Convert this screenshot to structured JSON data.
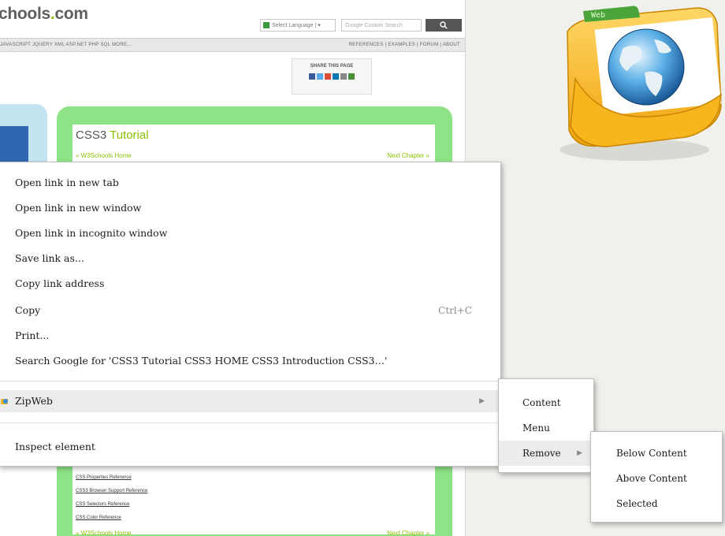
{
  "page": {
    "logo_prefix": "chools",
    "logo_dot": ".",
    "logo_suffix": "com",
    "lang_select": "Select Language | ▾",
    "search_placeholder": "Google Custom Search",
    "search_button_icon": "search-icon",
    "nav_left": "JAVASCRIPT   JQUERY   XML   ASP.NET   PHP   SQL   MORE...",
    "nav_right": "REFERENCES  |  EXAMPLES  |  FORUM  |  ABOUT",
    "share_title": "SHARE THIS PAGE",
    "tutorial_title_css3": "CSS3",
    "tutorial_title_rest": "Tutorial",
    "prev_link": "« W3Schools Home",
    "next_link": "Next Chapter »",
    "refs": [
      "CSS Properties Reference",
      "CSS3 Browser Support Reference",
      "CSS Selectors Reference",
      "CSS Color Reference"
    ],
    "prev_link_bottom": "« W3Schools Home",
    "next_link_bottom": "Next Chapter »"
  },
  "folder_label": "Web",
  "context_menu": {
    "items": [
      {
        "label": "Open link in new tab"
      },
      {
        "label": "Open link in new window"
      },
      {
        "label": "Open link in incognito window"
      },
      {
        "label": "Save link as..."
      },
      {
        "label": "Copy link address"
      },
      {
        "label": "Copy",
        "shortcut": "Ctrl+C"
      },
      {
        "label": "Print..."
      },
      {
        "label": "Search Google for 'CSS3 Tutorial CSS3 HOME CSS3 Introduction CSS3…'"
      }
    ],
    "zipweb": {
      "label": "ZipWeb",
      "icon": "zipweb-icon",
      "arrow": "▶"
    },
    "inspect": {
      "label": "Inspect element"
    }
  },
  "zipweb_submenu": {
    "items": [
      {
        "label": "Content"
      },
      {
        "label": "Menu"
      },
      {
        "label": "Remove",
        "arrow": "▶"
      }
    ]
  },
  "remove_submenu": {
    "items": [
      {
        "label": "Below Content"
      },
      {
        "label": "Above Content"
      },
      {
        "label": "Selected"
      }
    ]
  },
  "colors": {
    "brand_green": "#8ac007",
    "panel_green": "#8fe387",
    "menu_highlight": "#ececec"
  }
}
